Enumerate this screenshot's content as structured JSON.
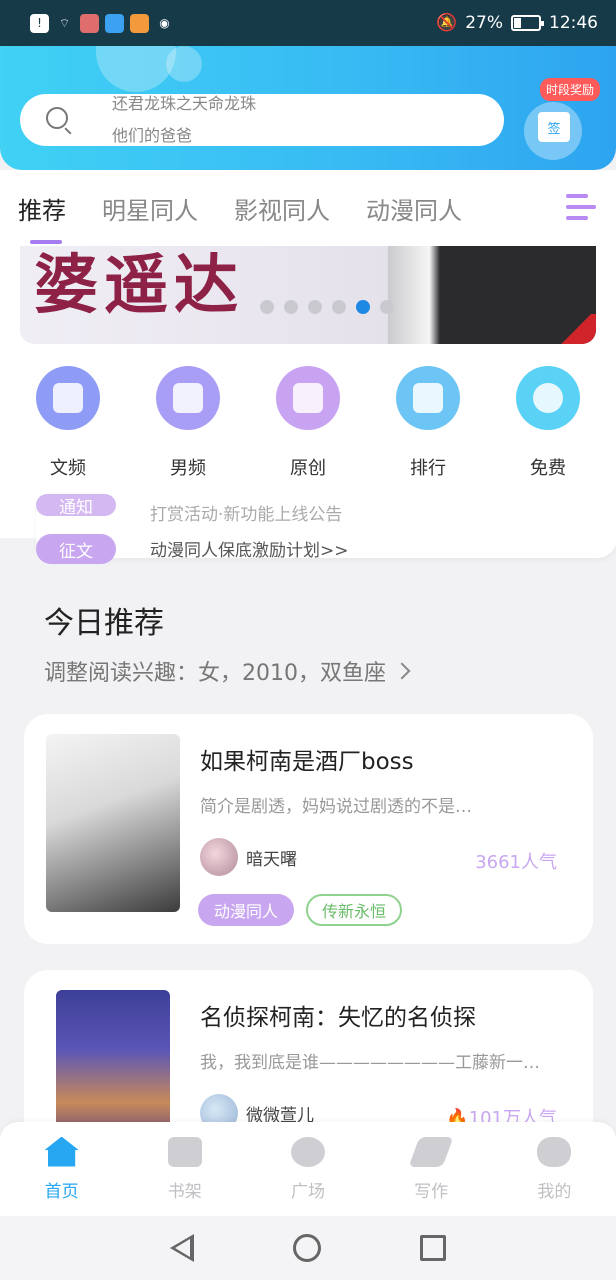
{
  "statusbar": {
    "battery_text": "27%",
    "battery_level": 0.27,
    "time": "12:46"
  },
  "search": {
    "ticker_line1": "还君龙珠之天命龙珠",
    "ticker_line2": "他们的爸爸"
  },
  "reward": {
    "badge": "时段奖励",
    "gift_label": "签"
  },
  "tabs": [
    {
      "label": "推荐",
      "active": true
    },
    {
      "label": "明星同人",
      "active": false
    },
    {
      "label": "影视同人",
      "active": false
    },
    {
      "label": "动漫同人",
      "active": false
    }
  ],
  "banner": {
    "art_text": "婆遥达",
    "dots_total": 6,
    "dots_active_index": 4
  },
  "categories": [
    {
      "label": "文频",
      "color": "#8f9cf6",
      "icon": "dress-icon"
    },
    {
      "label": "男频",
      "color": "#a99ef5",
      "icon": "shirt-icon"
    },
    {
      "label": "原创",
      "color": "#c7a3f2",
      "icon": "book-icon"
    },
    {
      "label": "排行",
      "color": "#6cc5f5",
      "icon": "trophy-icon"
    },
    {
      "label": "免费",
      "color": "#5ad2f6",
      "icon": "coin-icon"
    }
  ],
  "notices": [
    {
      "tag": "通知",
      "text": "打赏活动·新功能上线公告"
    },
    {
      "tag": "征文",
      "text": "动漫同人保底激励计划>>"
    }
  ],
  "today": {
    "title": "今日推荐",
    "subtitle": "调整阅读兴趣：女，2010，双鱼座"
  },
  "books": [
    {
      "title": "如果柯南是酒厂boss",
      "desc": "简介是剧透，妈妈说过剧透的不是…",
      "author": "暗天曙",
      "popularity": "3661人气",
      "tags": [
        "动漫同人",
        "传新永恒"
      ]
    },
    {
      "title": "名侦探柯南：失忆的名侦探",
      "desc": "我，我到底是谁————————工藤新一…",
      "author": "微微萱儿",
      "popularity": "101万人气",
      "tags": []
    }
  ],
  "bottom_nav": [
    {
      "label": "首页",
      "active": true
    },
    {
      "label": "书架",
      "active": false
    },
    {
      "label": "广场",
      "active": false
    },
    {
      "label": "写作",
      "active": false
    },
    {
      "label": "我的",
      "active": false
    }
  ],
  "colors": {
    "accent_blue": "#27a7f1",
    "accent_purple": "#c9a7f0",
    "header_gradient_start": "#40d1f4",
    "header_gradient_end": "#2ea4f0"
  }
}
